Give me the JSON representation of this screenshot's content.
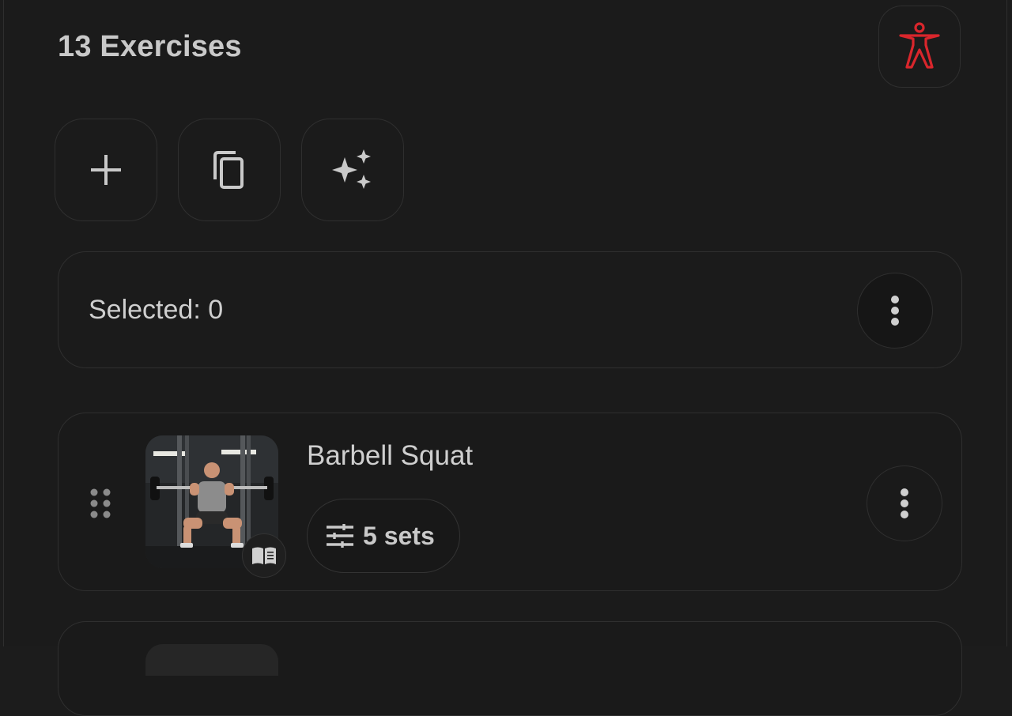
{
  "header": {
    "title": "13 Exercises",
    "body_button_icon": "accessibility-figure-icon",
    "accent_color": "#d9262c"
  },
  "toolbar": {
    "buttons": [
      {
        "icon": "plus-icon"
      },
      {
        "icon": "copy-icon"
      },
      {
        "icon": "sparkles-icon"
      }
    ]
  },
  "selection": {
    "label": "Selected: 0",
    "menu_icon": "more-vertical-icon"
  },
  "exercises": [
    {
      "name": "Barbell Squat",
      "sets_label": "5 sets",
      "thumbnail_icon": "exercise-photo",
      "badge_icon": "book-icon",
      "sets_icon": "sliders-icon",
      "menu_icon": "more-vertical-icon",
      "drag_icon": "drag-handle-icon"
    }
  ]
}
